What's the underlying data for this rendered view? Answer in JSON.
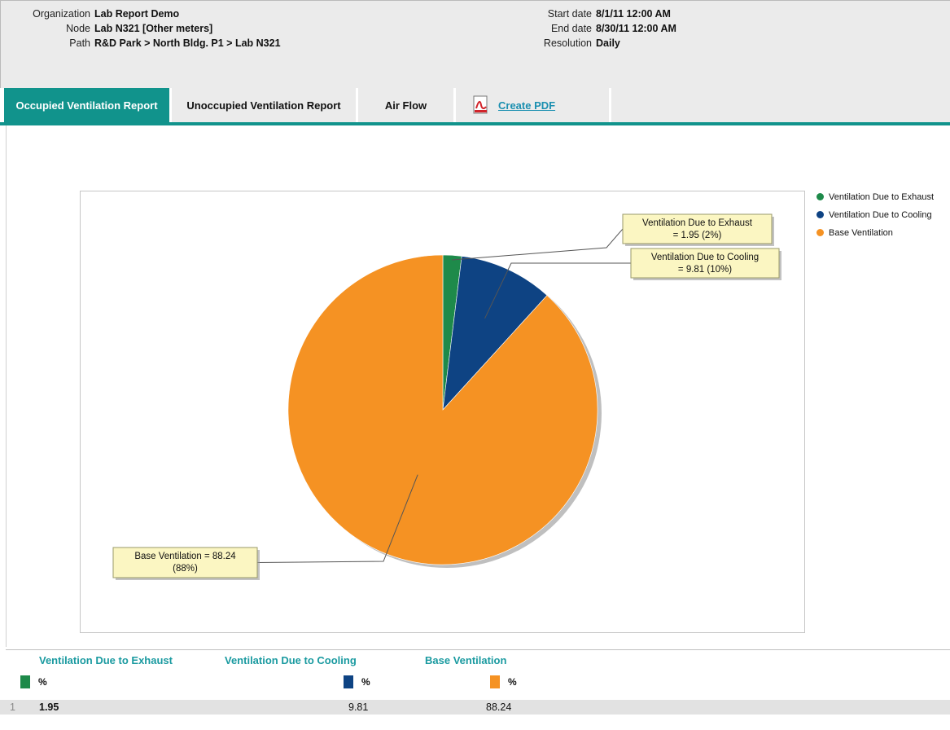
{
  "header": {
    "organization_label": "Organization",
    "organization_value": "Lab Report Demo",
    "node_label": "Node",
    "node_value": "Lab N321 [Other meters]",
    "path_label": "Path",
    "path_value": "R&D Park > North Bldg. P1 > Lab N321",
    "start_label": "Start date",
    "start_value": "8/1/11 12:00 AM",
    "end_label": "End date",
    "end_value": "8/30/11 12:00 AM",
    "resolution_label": "Resolution",
    "resolution_value": "Daily"
  },
  "tabs": [
    {
      "label": "Occupied Ventilation Report",
      "active": true
    },
    {
      "label": "Unoccupied Ventilation Report",
      "active": false
    },
    {
      "label": "Air Flow",
      "active": false
    }
  ],
  "pdf": {
    "label": "Create PDF",
    "icon": "pdf-file-icon"
  },
  "chart_data": {
    "type": "pie",
    "slices": [
      {
        "name": "Ventilation Due to Exhaust",
        "value": 1.95,
        "percent": 2,
        "color": "#1e8a4a",
        "label_line1": "Ventilation Due to Exhaust",
        "label_line2": "= 1.95 (2%)"
      },
      {
        "name": "Ventilation Due to Cooling",
        "value": 9.81,
        "percent": 10,
        "color": "#0e4383",
        "label_line1": "Ventilation Due to Cooling",
        "label_line2": "= 9.81 (10%)"
      },
      {
        "name": "Base Ventilation",
        "value": 88.24,
        "percent": 88,
        "color": "#f59223",
        "label_line1": "Base Ventilation = 88.24",
        "label_line2": "(88%)"
      }
    ],
    "legend": [
      "Ventilation Due to Exhaust",
      "Ventilation Due to Cooling",
      "Base Ventilation"
    ],
    "legend_position": "right"
  },
  "table": {
    "columns": [
      {
        "header": "Ventilation Due to Exhaust",
        "unit": "%",
        "color": "#1e8a4a"
      },
      {
        "header": "Ventilation Due to Cooling",
        "unit": "%",
        "color": "#0e4383"
      },
      {
        "header": "Base Ventilation",
        "unit": "%",
        "color": "#f59223"
      }
    ],
    "rows": [
      {
        "index": "1",
        "values": [
          "1.95",
          "9.81",
          "88.24"
        ]
      }
    ]
  }
}
